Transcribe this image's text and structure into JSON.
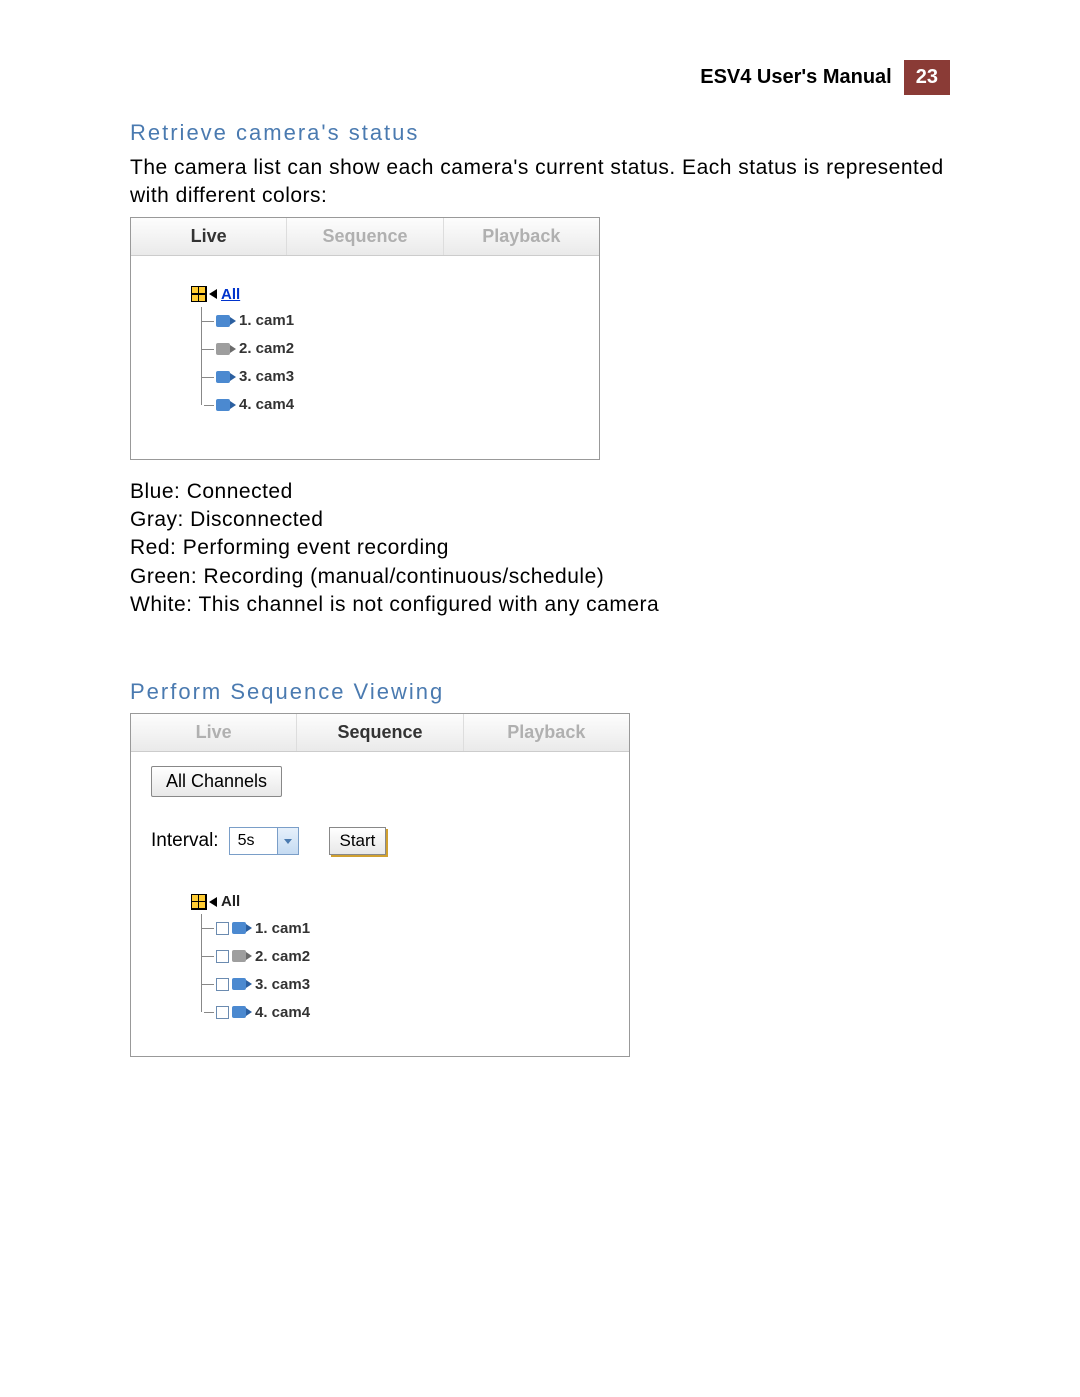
{
  "header": {
    "title": "ESV4 User's Manual",
    "page": "23"
  },
  "section1": {
    "heading": "Retrieve camera's status",
    "intro": "The camera list can show each camera's current status. Each status is represented with different colors:",
    "tabs": {
      "live": "Live",
      "sequence": "Sequence",
      "playback": "Playback"
    },
    "tree": {
      "all": "All",
      "items": [
        {
          "label": "1. cam1",
          "color": "blue"
        },
        {
          "label": "2. cam2",
          "color": "gray"
        },
        {
          "label": "3. cam3",
          "color": "blue"
        },
        {
          "label": "4. cam4",
          "color": "blue"
        }
      ]
    },
    "legend": {
      "blue": "Blue: Connected",
      "gray": "Gray: Disconnected",
      "red": "Red: Performing event recording",
      "green": "Green: Recording (manual/continuous/schedule)",
      "white": "White: This channel is not configured with any camera"
    }
  },
  "section2": {
    "heading": "Perform Sequence Viewing",
    "tabs": {
      "live": "Live",
      "sequence": "Sequence",
      "playback": "Playback"
    },
    "all_channels_btn": "All Channels",
    "interval_label": "Interval:",
    "interval_value": "5s",
    "start_btn": "Start",
    "tree": {
      "all": "All",
      "items": [
        {
          "label": "1. cam1",
          "color": "blue"
        },
        {
          "label": "2. cam2",
          "color": "gray"
        },
        {
          "label": "3. cam3",
          "color": "blue"
        },
        {
          "label": "4. cam4",
          "color": "blue"
        }
      ]
    }
  }
}
